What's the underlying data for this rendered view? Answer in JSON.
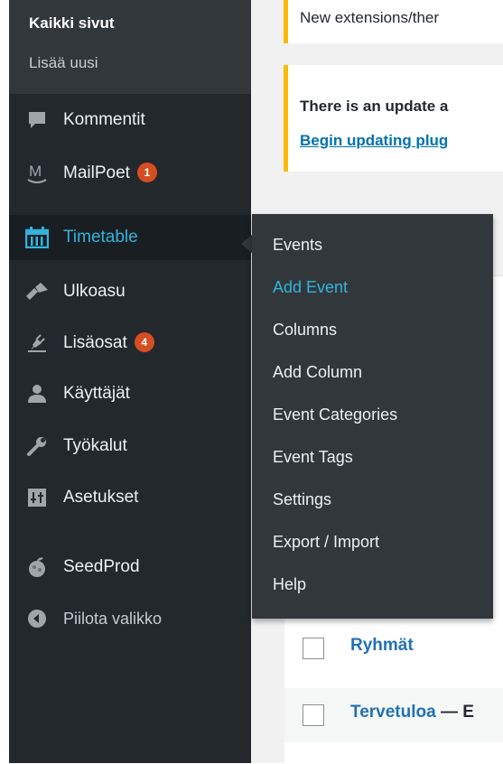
{
  "submenu_top": {
    "current": "Kaikki sivut",
    "add_new": "Lisää uusi"
  },
  "menu": [
    {
      "label": "Kommentit",
      "icon": "comment-icon"
    },
    {
      "label": "MailPoet",
      "icon": "mailpoet-icon",
      "badge": "1"
    },
    {
      "label": "Timetable",
      "icon": "calendar-icon",
      "active": true
    },
    {
      "label": "Ulkoasu",
      "icon": "paintbrush-icon"
    },
    {
      "label": "Lisäosat",
      "icon": "plugin-icon",
      "badge": "4"
    },
    {
      "label": "Käyttäjät",
      "icon": "users-icon"
    },
    {
      "label": "Työkalut",
      "icon": "wrench-icon"
    },
    {
      "label": "Asetukset",
      "icon": "settings-sliders-icon"
    },
    {
      "label": "SeedProd",
      "icon": "seedprod-icon"
    },
    {
      "label": "Piilota valikko",
      "icon": "collapse-arrow-icon"
    }
  ],
  "flyout": [
    {
      "label": "Events"
    },
    {
      "label": "Add Event",
      "current": true
    },
    {
      "label": "Columns"
    },
    {
      "label": "Add Column"
    },
    {
      "label": "Event Categories"
    },
    {
      "label": "Event Tags"
    },
    {
      "label": "Settings"
    },
    {
      "label": "Export / Import"
    },
    {
      "label": "Help"
    }
  ],
  "notices": {
    "first": "New extensions/ther",
    "second_text": "There is an update a",
    "second_link": "Begin updating plug"
  },
  "rows": [
    {
      "title": "Ryhmät",
      "suffix": ""
    },
    {
      "title": "Tervetuloa",
      "suffix": " — E"
    }
  ],
  "colors": {
    "sidebar": "#23282d",
    "submenu": "#32373c",
    "accent": "#33b3db",
    "badge": "#d54e21",
    "notice_border": "#ffb900",
    "link": "#0073aa"
  }
}
